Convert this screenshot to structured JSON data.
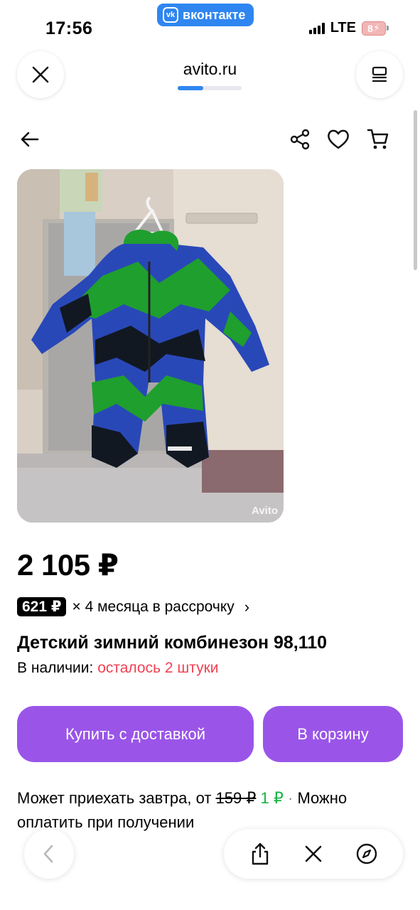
{
  "status_bar": {
    "time": "17:56",
    "app_pill": "вконтакте",
    "vk_logo": "vk",
    "network": "LTE",
    "battery": "8"
  },
  "browser": {
    "url": "avito.ru",
    "load_progress": 0.4
  },
  "product": {
    "price": "2 105 ₽",
    "installment_amount": "621 ₽",
    "installment_text": "× 4 месяца в рассрочку",
    "title": "Детский зимний комбинезон 98,110",
    "stock_label": "В наличии:",
    "stock_remaining": "осталось 2 штуки",
    "watermark": "Avito"
  },
  "actions": {
    "buy_delivery": "Купить с доставкой",
    "add_to_cart": "В корзину"
  },
  "delivery": {
    "text_before": "Может приехать завтра, от ",
    "old_price": "159 ₽",
    "new_price": "1 ₽",
    "separator": " · ",
    "text_after": "Можно оплатить при получении"
  },
  "colors": {
    "accent": "#9a55e8",
    "stock_red": "#f04153",
    "new_price_green": "#16b543",
    "vk_blue": "#2f86f0"
  }
}
